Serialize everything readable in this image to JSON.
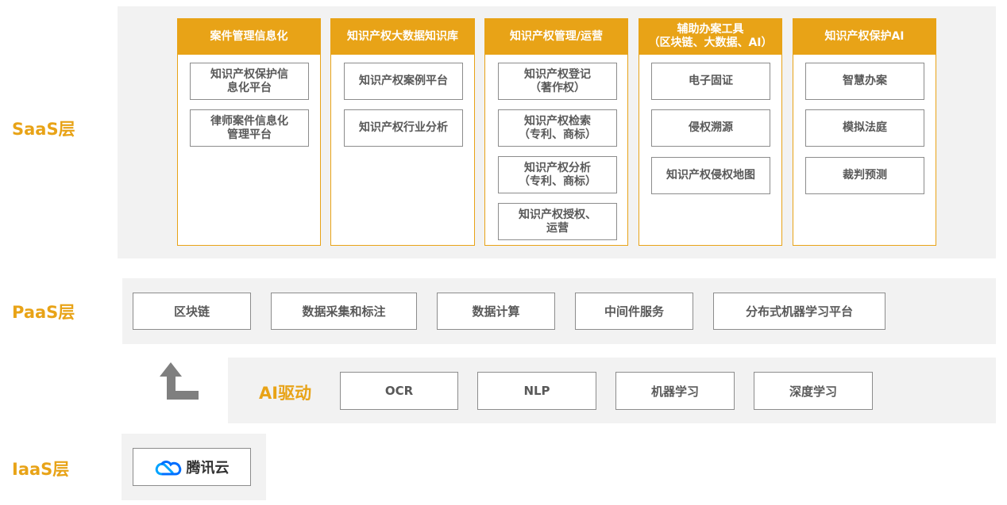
{
  "layers": {
    "saas": "SaaS层",
    "paas": "PaaS层",
    "iaas": "IaaS层"
  },
  "saas_columns": [
    {
      "header": "案件管理信息化",
      "items": [
        "知识产权保护信\n息化平台",
        "律师案件信息化\n管理平台"
      ]
    },
    {
      "header": "知识产权大数据知识库",
      "items": [
        "知识产权案例平台",
        "知识产权行业分析"
      ]
    },
    {
      "header": "知识产权管理/运营",
      "items": [
        "知识产权登记\n（著作权）",
        "知识产权检索\n（专利、商标）",
        "知识产权分析\n（专利、商标）",
        "知识产权授权、\n运营"
      ]
    },
    {
      "header": "辅助办案工具\n（区块链、大数据、AI）",
      "items": [
        "电子固证",
        "侵权溯源",
        "知识产权侵权地图"
      ]
    },
    {
      "header": "知识产权保护AI",
      "items": [
        "智慧办案",
        "模拟法庭",
        "裁判预测"
      ]
    }
  ],
  "paas_items": [
    "区块链",
    "数据采集和标注",
    "数据计算",
    "中间件服务",
    "分布式机器学习平台"
  ],
  "ai": {
    "label": "AI驱动",
    "items": [
      "OCR",
      "NLP",
      "机器学习",
      "深度学习"
    ]
  },
  "iaas": {
    "logo_text": "腾讯云"
  },
  "colors": {
    "accent": "#e8a317",
    "panel": "#f2f2f2",
    "box_border": "#8c8c8c",
    "text": "#595959",
    "arrow": "#7f7f7f"
  }
}
